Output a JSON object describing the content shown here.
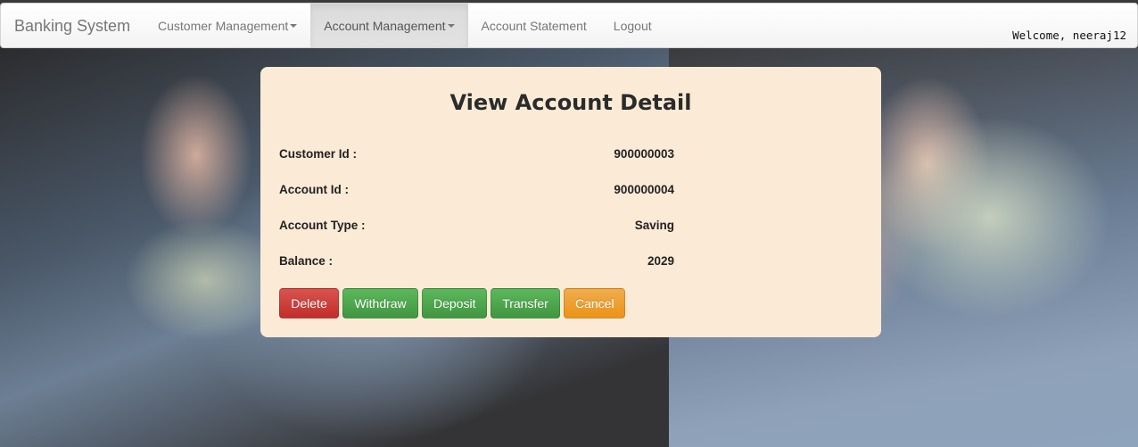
{
  "navbar": {
    "brand": "Banking System",
    "items": [
      {
        "label": "Customer Management",
        "dropdown": true,
        "active": false
      },
      {
        "label": "Account Management",
        "dropdown": true,
        "active": true
      },
      {
        "label": "Account Statement",
        "dropdown": false,
        "active": false
      },
      {
        "label": "Logout",
        "dropdown": false,
        "active": false
      }
    ],
    "welcome": "Welcome, neeraj12"
  },
  "panel": {
    "title": "View Account Detail",
    "fields": [
      {
        "label": "Customer Id :",
        "value": "900000003"
      },
      {
        "label": "Account Id :",
        "value": "900000004"
      },
      {
        "label": "Account Type :",
        "value": "Saving"
      },
      {
        "label": "Balance :",
        "value": "2029"
      }
    ],
    "buttons": {
      "delete": "Delete",
      "withdraw": "Withdraw",
      "deposit": "Deposit",
      "transfer": "Transfer",
      "cancel": "Cancel"
    }
  },
  "colors": {
    "panel_bg": "#fbebd6",
    "danger": "#d9534f",
    "success": "#5cb85c",
    "warning": "#f0ad4e"
  }
}
